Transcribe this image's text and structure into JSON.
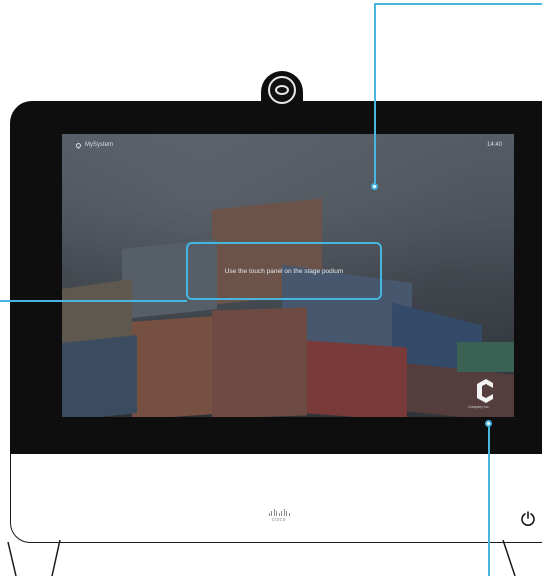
{
  "screen": {
    "system_name": "MySystem",
    "clock": "14:40",
    "message": "Use the touch panel on the stage podium",
    "brand_caption": "Company Inc."
  },
  "device": {
    "vendor_logo_text": "cisco",
    "camera_icon": "camera-icon",
    "power_icon": "power-icon",
    "location_icon": "location-pin-icon"
  },
  "colors": {
    "callout": "#46b5e0",
    "bezel": "#0e0e0e"
  }
}
